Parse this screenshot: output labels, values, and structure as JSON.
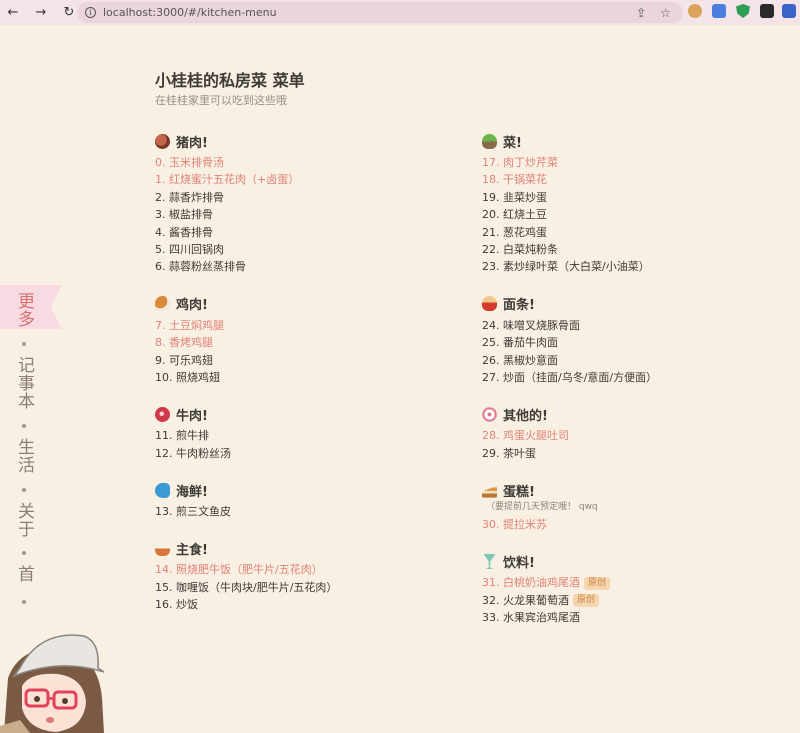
{
  "browser": {
    "url": "localhost:3000/#/kitchen-menu",
    "back_icon": "arrow-left-icon",
    "forward_icon": "arrow-right-icon",
    "reload_icon": "reload-icon",
    "info_icon": "info-icon",
    "share_icon": "share-icon",
    "star_icon": "star-icon",
    "info_glyph": "i",
    "share_glyph": "⇪",
    "star_glyph": "☆"
  },
  "sidebar": {
    "items": [
      {
        "label": "更多",
        "active": true
      },
      {
        "label": "记事本"
      },
      {
        "label": "生活"
      },
      {
        "label": "关于"
      },
      {
        "label": "首"
      }
    ]
  },
  "header": {
    "title": "小桂桂的私房菜 菜单",
    "subtitle": "在桂桂家里可以吃到这些哦"
  },
  "colors": {
    "background": "#f8f0e3",
    "highlight": "#e08277",
    "tag_bg": "#f6d6b0",
    "tag_text": "#c9803c"
  },
  "menu": {
    "left": [
      {
        "icon": "meat-icon",
        "title": "猪肉!",
        "items": [
          {
            "text": "0. 玉米排骨汤",
            "highlight": true
          },
          {
            "text": "1. 红烧蜜汁五花肉（+卤蛋）",
            "highlight": true
          },
          {
            "text": "2. 蒜香炸排骨"
          },
          {
            "text": "3. 椒盐排骨"
          },
          {
            "text": "4. 酱香排骨"
          },
          {
            "text": "5. 四川回锅肉"
          },
          {
            "text": "6. 蒜蓉粉丝蒸排骨"
          }
        ]
      },
      {
        "icon": "chicken-leg-icon",
        "title": "鸡肉!",
        "items": [
          {
            "text": "7. 土豆焖鸡腿",
            "highlight": true
          },
          {
            "text": "8. 香烤鸡腿",
            "highlight": true
          },
          {
            "text": "9. 可乐鸡翅"
          },
          {
            "text": "10. 照烧鸡翅"
          }
        ]
      },
      {
        "icon": "steak-icon",
        "title": "牛肉!",
        "items": [
          {
            "text": "11. 煎牛排"
          },
          {
            "text": "12. 牛肉粉丝汤"
          }
        ]
      },
      {
        "icon": "fish-icon",
        "title": "海鲜!",
        "items": [
          {
            "text": "13. 煎三文鱼皮"
          }
        ]
      },
      {
        "icon": "rice-bowl-icon",
        "title": "主食!",
        "items": [
          {
            "text": "14. 照烧肥牛饭（肥牛片/五花肉）",
            "highlight": true
          },
          {
            "text": "15. 咖喱饭（牛肉块/肥牛片/五花肉）"
          },
          {
            "text": "16. 炒饭"
          }
        ]
      }
    ],
    "right": [
      {
        "icon": "salad-icon",
        "title": "菜!",
        "items": [
          {
            "text": "17. 肉丁炒芹菜",
            "highlight": true
          },
          {
            "text": "18. 干锅菜花",
            "highlight": true
          },
          {
            "text": "19. 韭菜炒蛋"
          },
          {
            "text": "20. 红烧土豆"
          },
          {
            "text": "21. 葱花鸡蛋"
          },
          {
            "text": "22. 白菜炖粉条"
          },
          {
            "text": "23. 素炒绿叶菜（大白菜/小油菜）"
          }
        ]
      },
      {
        "icon": "noodle-bowl-icon",
        "title": "面条!",
        "items": [
          {
            "text": "24. 味噌叉烧豚骨面"
          },
          {
            "text": "25. 番茄牛肉面"
          },
          {
            "text": "26. 黑椒炒意面"
          },
          {
            "text": "27. 炒面（挂面/乌冬/意面/方便面）"
          }
        ]
      },
      {
        "icon": "fishcake-icon",
        "title": "其他的!",
        "items": [
          {
            "text": "28. 鸡蛋火腿吐司",
            "highlight": true
          },
          {
            "text": "29. 茶叶蛋"
          }
        ]
      },
      {
        "icon": "cake-icon",
        "title": "蛋糕!",
        "note": "（要提前几天预定哦！ qwq",
        "items": [
          {
            "text": "30. 提拉米苏",
            "highlight": true
          }
        ]
      },
      {
        "icon": "cocktail-icon",
        "title": "饮料!",
        "items": [
          {
            "text": "31. 白桃奶油鸡尾酒",
            "highlight": true,
            "tag": "原创"
          },
          {
            "text": "32. 火龙果葡萄酒",
            "tag": "原创"
          },
          {
            "text": "33. 水果宾治鸡尾酒"
          }
        ]
      }
    ]
  }
}
